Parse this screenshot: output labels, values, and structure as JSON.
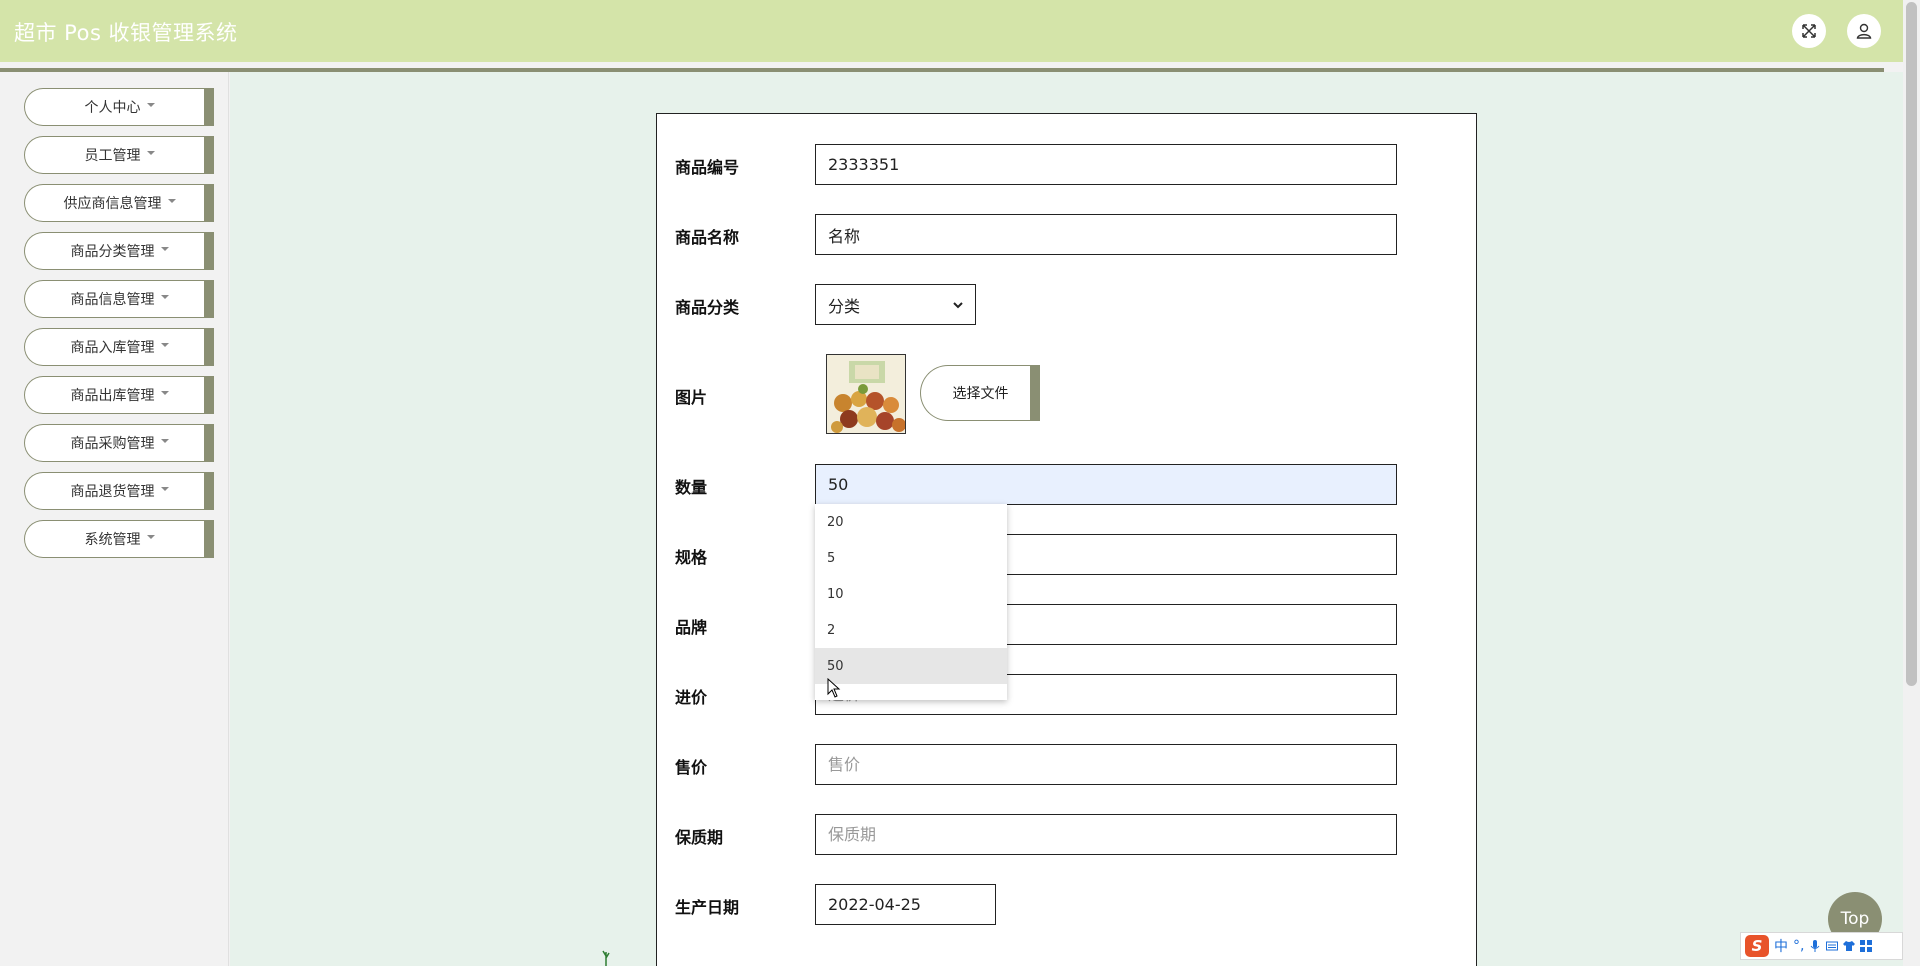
{
  "header": {
    "title": "超市 Pos 收银管理系统",
    "fullscreen_icon": "expand-icon",
    "user_icon": "user-icon"
  },
  "sidebar": {
    "items": [
      {
        "label": "个人中心"
      },
      {
        "label": "员工管理"
      },
      {
        "label": "供应商信息管理"
      },
      {
        "label": "商品分类管理"
      },
      {
        "label": "商品信息管理"
      },
      {
        "label": "商品入库管理"
      },
      {
        "label": "商品出库管理"
      },
      {
        "label": "商品采购管理"
      },
      {
        "label": "商品退货管理"
      },
      {
        "label": "系统管理"
      }
    ]
  },
  "form": {
    "code": {
      "label": "商品编号",
      "value": "2333351"
    },
    "name": {
      "label": "商品名称",
      "value": "名称"
    },
    "category": {
      "label": "商品分类",
      "value": "分类"
    },
    "image": {
      "label": "图片",
      "button": "选择文件"
    },
    "quantity": {
      "label": "数量",
      "value": "50"
    },
    "spec": {
      "label": "规格",
      "value": ""
    },
    "brand": {
      "label": "品牌",
      "value": ""
    },
    "cost": {
      "label": "进价",
      "placeholder": "进价"
    },
    "price": {
      "label": "售价",
      "placeholder": "售价"
    },
    "shelf_life": {
      "label": "保质期",
      "placeholder": "保质期"
    },
    "production_date": {
      "label": "生产日期",
      "value": "2022-04-25"
    }
  },
  "autocomplete": {
    "options": [
      "20",
      "5",
      "10",
      "2",
      "50"
    ],
    "highlighted": "50"
  },
  "top_button": {
    "label": "Top"
  },
  "ime": {
    "logo": "S",
    "mode": "中",
    "punct": "°,"
  },
  "colors": {
    "header_bg": "#d4e4a9",
    "accent": "#8a8f73",
    "main_bg": "#e7f2eb",
    "sidebar_bg": "#f2f2f2"
  }
}
